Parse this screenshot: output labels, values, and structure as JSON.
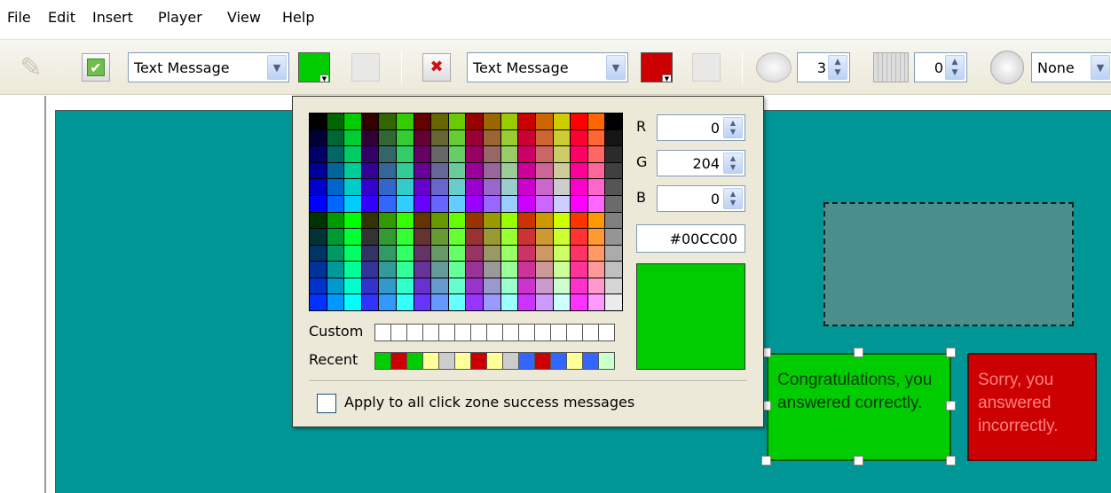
{
  "menu": [
    "File",
    "Edit",
    "Insert",
    "Player",
    "View",
    "Help"
  ],
  "toolbar": {
    "success": {
      "message_type": "Text Message",
      "color": "#00cc00"
    },
    "failure": {
      "message_type": "Text Message",
      "color": "#cc0000"
    },
    "attempts_value": "3",
    "grid_value": "0",
    "timer_value": "None"
  },
  "picker": {
    "r_label": "R",
    "g_label": "G",
    "b_label": "B",
    "r": "0",
    "g": "204",
    "b": "0",
    "hex": "#00CC00",
    "preview_color": "#00cc00",
    "custom_label": "Custom",
    "recent_label": "Recent",
    "recent_colors": [
      "#00cc00",
      "#cc0000",
      "#00cc00",
      "#ffff99",
      "#cccccc",
      "#ffff99",
      "#cc0000",
      "#ffff99",
      "#cccccc",
      "#3366ff",
      "#cc0000",
      "#3366ff",
      "#ffff99",
      "#3366ff",
      "#ccffcc"
    ],
    "apply_label": "Apply to all click zone success messages",
    "apply_checked": false
  },
  "canvas": {
    "success_message": "Congratulations, you answered correctly.",
    "failure_message": "Sorry, you answered incorrectly."
  }
}
